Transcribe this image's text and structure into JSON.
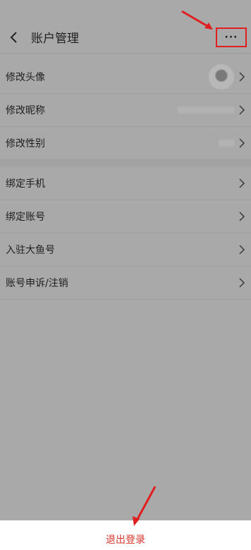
{
  "header": {
    "title": "账户管理",
    "back_icon": "chevron-left-icon",
    "more_label": "···"
  },
  "group1": [
    {
      "label": "修改头像",
      "value_kind": "avatar"
    },
    {
      "label": "修改昵称",
      "value_kind": "blurred"
    },
    {
      "label": "修改性别",
      "value_kind": "blurred-short"
    }
  ],
  "group2": [
    {
      "label": "绑定手机"
    },
    {
      "label": "绑定账号"
    },
    {
      "label": "入驻大鱼号"
    },
    {
      "label": "账号申诉/注销"
    }
  ],
  "footer": {
    "logout_label": "退出登录"
  },
  "colors": {
    "overlay": "#a9a9a9",
    "annotation": "#e02020",
    "logout": "#d9342b"
  }
}
